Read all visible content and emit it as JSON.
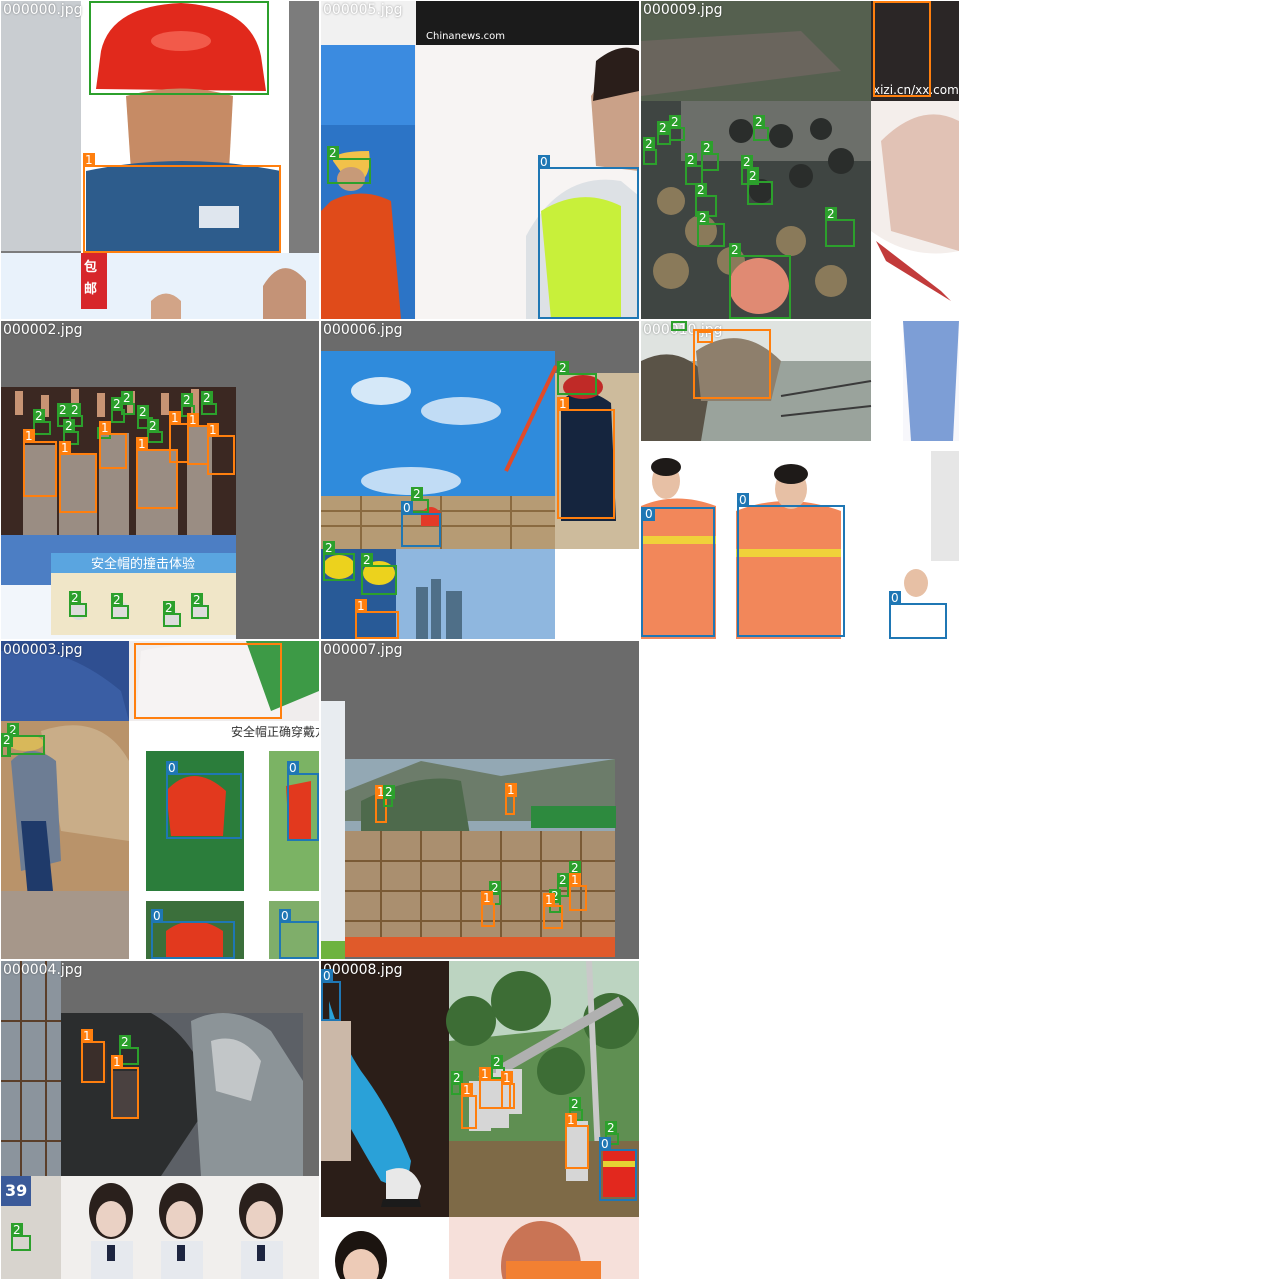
{
  "grid": {
    "tiles": [
      {
        "label": "000000.jpg"
      },
      {
        "label": "000005.jpg"
      },
      {
        "label": "000009.jpg"
      },
      {
        "label": "000002.jpg"
      },
      {
        "label": "000006.jpg"
      },
      {
        "label": "000010.jpg"
      },
      {
        "label": "000003.jpg"
      },
      {
        "label": "000007.jpg"
      },
      {
        "label": "000004.jpg"
      },
      {
        "label": "000008.jpg"
      }
    ]
  },
  "classes": {
    "0": {
      "color": "#1f77b4"
    },
    "1": {
      "color": "#ff7f0e"
    },
    "2": {
      "color": "#2ca02c"
    }
  },
  "embedded_text": {
    "watermark_chinanews": "Chinanews.com",
    "watermark_xizi": "xizi.cn/xx.com",
    "badge_baoyou": "包邮",
    "sign_construction": "安全帽的撞击体验",
    "poster_title": "安全帽正确穿戴方法",
    "number_39": "39"
  }
}
